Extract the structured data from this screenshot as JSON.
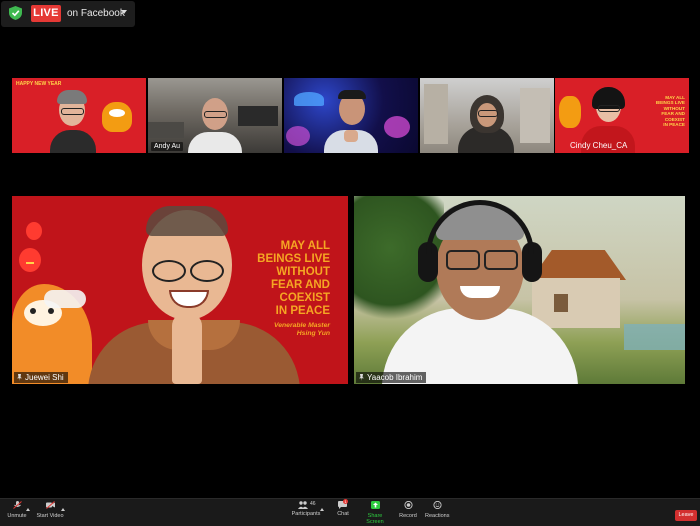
{
  "live": {
    "badge": "LIVE",
    "destination": "on Facebook",
    "shield_color": "#3fb950",
    "badge_color": "#e53935"
  },
  "thumbnails": [
    {
      "name": "",
      "bg": "#d91f27",
      "banner": "HAPPY NEW YEAR"
    },
    {
      "name": "Andy Au",
      "bg": "#6f6a63"
    },
    {
      "name": "",
      "bg": "#120f4a"
    },
    {
      "name": "",
      "bg": "#a9a49c"
    },
    {
      "name": "Cindy Cheu_CA",
      "bg": "#d91f27",
      "banner_lines": [
        "MAY ALL",
        "BEINGS LIVE",
        "WITHOUT",
        "FEAR AND",
        "COEXIST",
        "IN PEACE"
      ]
    }
  ],
  "main_left": {
    "name": "Juewei Shi",
    "quote_lines": [
      "MAY ALL",
      "BEINGS LIVE",
      "WITHOUT",
      "FEAR AND",
      "COEXIST",
      "IN PEACE"
    ],
    "attribution_lines": [
      "Venerable Master",
      "Hsing Yun"
    ],
    "bg": "#c0141a",
    "quote_color": "#f5a623"
  },
  "main_right": {
    "name": "Yaacob Ibrahim"
  },
  "toolbar": {
    "unmute": "Unmute",
    "start_video": "Start Video",
    "participants": "Participants",
    "participants_count": "46",
    "chat": "Chat",
    "chat_badge": "1",
    "share_screen": "Share Screen",
    "record": "Record",
    "reactions": "Reactions",
    "leave": "Leave",
    "share_color": "#2ecc40",
    "leave_color": "#d32f2f"
  }
}
